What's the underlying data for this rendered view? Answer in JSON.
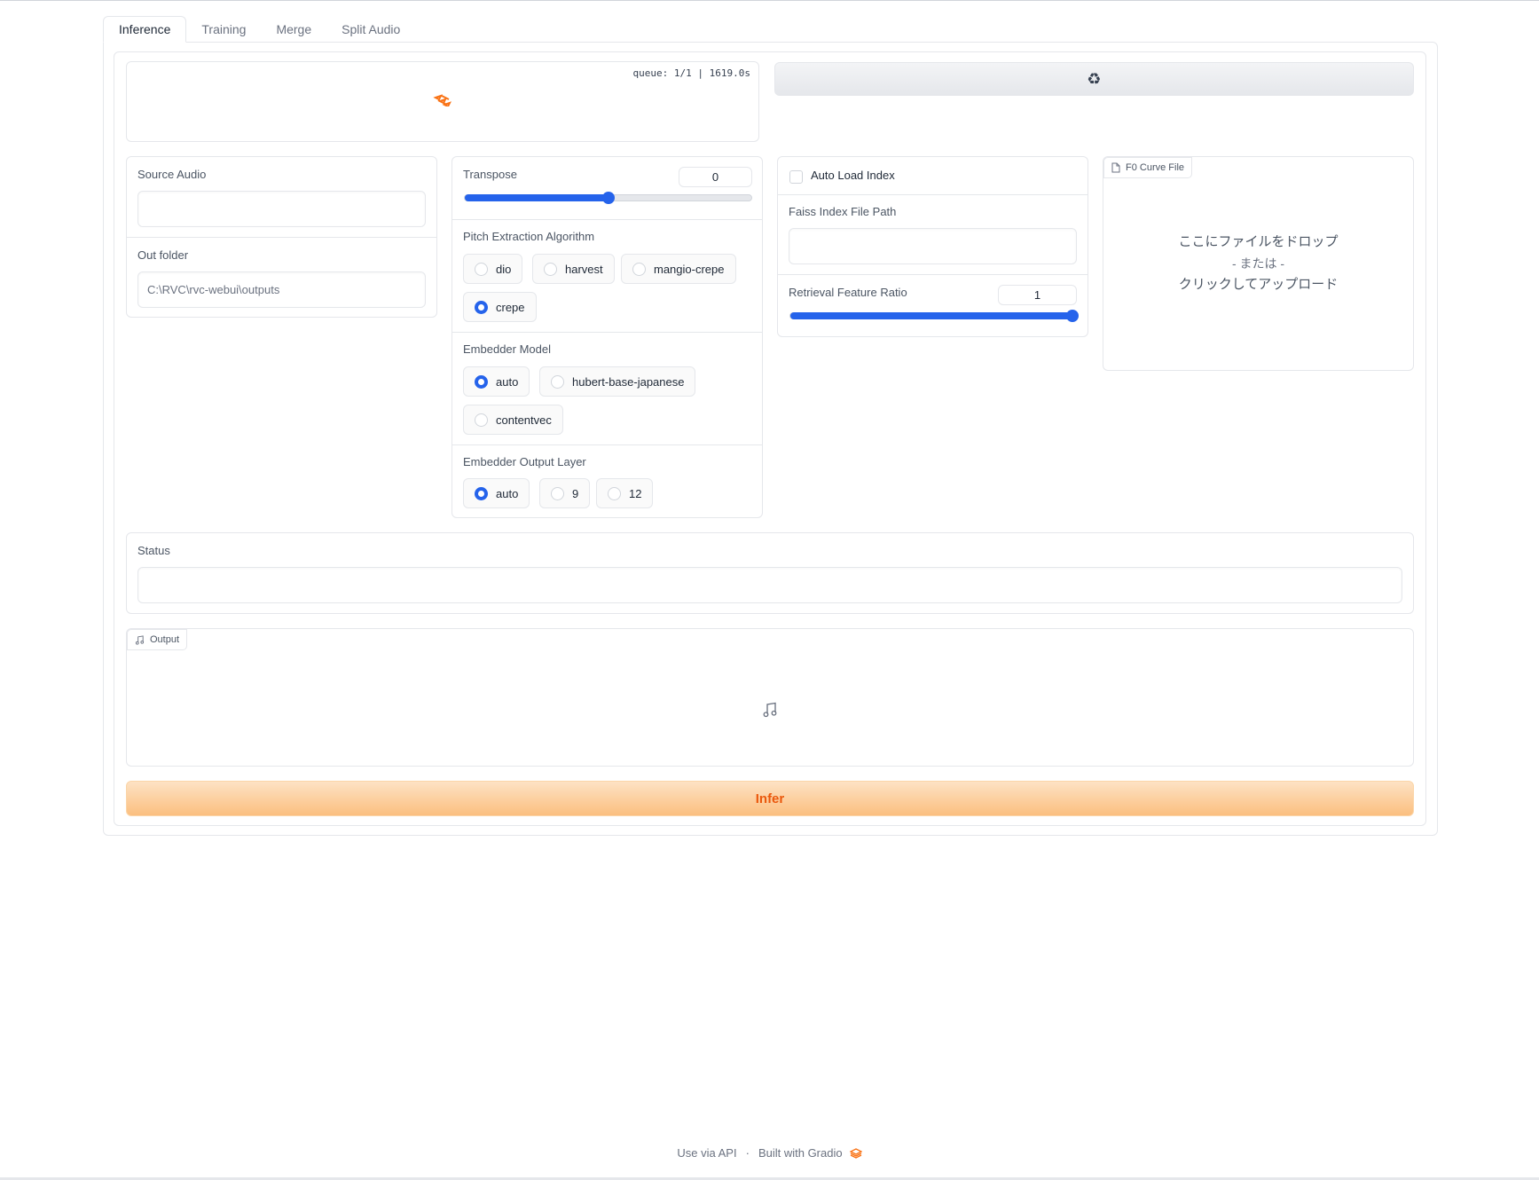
{
  "tabs": [
    {
      "label": "Inference",
      "active": true
    },
    {
      "label": "Training",
      "active": false
    },
    {
      "label": "Merge",
      "active": false
    },
    {
      "label": "Split Audio",
      "active": false
    }
  ],
  "model_panel": {
    "queue_text": "queue: 1/1 | 1619.0s",
    "loading_icon": "loader-icon",
    "refresh_icon": "recycle-icon",
    "refresh_glyph": "♻"
  },
  "source_audio": {
    "label": "Source Audio",
    "value": ""
  },
  "out_folder": {
    "label": "Out folder",
    "value": "C:\\RVC\\rvc-webui\\outputs"
  },
  "transpose": {
    "label": "Transpose",
    "value": "0",
    "min": -20,
    "max": 20,
    "current": 0
  },
  "pitch": {
    "label": "Pitch Extraction Algorithm",
    "options": [
      {
        "label": "dio",
        "selected": false
      },
      {
        "label": "harvest",
        "selected": false
      },
      {
        "label": "mangio-crepe",
        "selected": false
      },
      {
        "label": "crepe",
        "selected": true
      }
    ]
  },
  "embedder_model": {
    "label": "Embedder Model",
    "options": [
      {
        "label": "auto",
        "selected": true
      },
      {
        "label": "hubert-base-japanese",
        "selected": false
      },
      {
        "label": "contentvec",
        "selected": false
      }
    ]
  },
  "embedder_layer": {
    "label": "Embedder Output Layer",
    "options": [
      {
        "label": "auto",
        "selected": true
      },
      {
        "label": "9",
        "selected": false
      },
      {
        "label": "12",
        "selected": false
      }
    ]
  },
  "auto_load_index": {
    "label": "Auto Load Index",
    "checked": false
  },
  "faiss": {
    "label": "Faiss Index File Path",
    "value": ""
  },
  "retrieval": {
    "label": "Retrieval Feature Ratio",
    "value": "1",
    "min": 0,
    "max": 1,
    "current": 1
  },
  "f0_curve": {
    "badge": "F0 Curve File",
    "badge_icon": "file-icon",
    "drop_line1": "ここにファイルをドロップ",
    "drop_line2": "- または -",
    "drop_line3": "クリックしてアップロード"
  },
  "status": {
    "label": "Status",
    "value": ""
  },
  "output": {
    "badge": "Output",
    "badge_icon": "music-note-icon",
    "placeholder_icon": "music-note-icon"
  },
  "infer_button": "Infer",
  "footer": {
    "api": "Use via API",
    "separator": "·",
    "built": "Built with Gradio",
    "logo": "gradio-logo-icon"
  },
  "colors": {
    "accent": "#2563eb",
    "primary_button": "#fbbf7f",
    "primary_text": "#ea580c"
  }
}
